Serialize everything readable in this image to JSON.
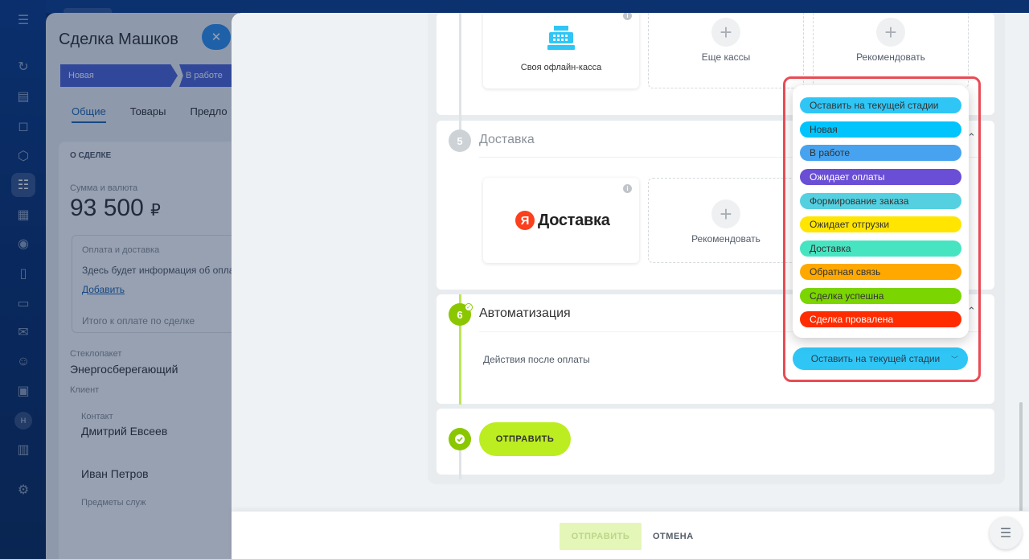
{
  "nav": {
    "icons": [
      "menu-icon",
      "activity-icon",
      "tasks-icon",
      "chat-icon",
      "hexagon-icon",
      "crm-funnel-icon",
      "calendar-icon",
      "robot-icon",
      "document-icon",
      "card-icon",
      "mail-icon",
      "contacts-icon",
      "monitor-icon",
      "user-badge-icon",
      "table-icon",
      "settings-icon"
    ],
    "user_initial": "Н"
  },
  "deal": {
    "title": "Сделка Машков",
    "stages": [
      "Новая",
      "В работе"
    ],
    "tabs": [
      "Общие",
      "Товары",
      "Предло"
    ],
    "section_title": "О СДЕЛКЕ",
    "amount_label": "Сумма и валюта",
    "amount": "93 500",
    "currency": "₽",
    "payment_title": "Оплата и доставка",
    "payment_text": "Здесь будет информация об опла",
    "add_link": "Добавить",
    "total_label": "Итого к оплате по сделке",
    "package_label": "Стеклопакет",
    "package_value": "Энергосберегающий",
    "client_label": "Клиент",
    "contact_label": "Контакт",
    "contact_1": "Дмитрий Евсеев",
    "contact_2": "Иван Петров",
    "more_label": "Предметы служ"
  },
  "kassy": {
    "own_kassa": "Своя офлайн-касса",
    "more_kassy": "Еще кассы",
    "recommend": "Рекомендовать"
  },
  "delivery": {
    "number": "5",
    "title": "Доставка",
    "ya_letter": "Я",
    "ya_name": "Доставка",
    "recommend": "Рекомендовать"
  },
  "automation": {
    "number": "6",
    "title": "Автоматизация",
    "action_label": "Действия после оплаты",
    "selected_stage": "Оставить на текущей стадии"
  },
  "send_label": "ОТПРАВИТЬ",
  "stage_options": [
    {
      "label": "Оставить на текущей стадии",
      "color": "#2fc6f6"
    },
    {
      "label": "Новая",
      "color": "#00c4fb"
    },
    {
      "label": "В работе",
      "color": "#47a3ef"
    },
    {
      "label": "Ожидает оплаты",
      "color": "#6a4ed6"
    },
    {
      "label": "Формирование заказа",
      "color": "#55d0e0"
    },
    {
      "label": "Ожидает отгрузки",
      "color": "#ffe500"
    },
    {
      "label": "Доставка",
      "color": "#47e4c2"
    },
    {
      "label": "Обратная связь",
      "color": "#ffa900"
    },
    {
      "label": "Сделка успешна",
      "color": "#7bd500"
    },
    {
      "label": "Сделка провалена",
      "color": "#ff2c00"
    }
  ],
  "footer": {
    "send": "ОТПРАВИТЬ",
    "cancel": "ОТМЕНА"
  }
}
